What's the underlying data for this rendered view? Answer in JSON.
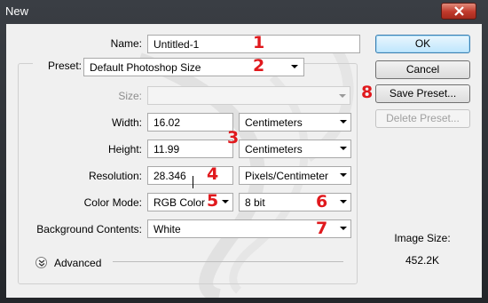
{
  "window": {
    "title": "New"
  },
  "form": {
    "name_label": "Name:",
    "name_value": "Untitled-1",
    "preset_label": "Preset:",
    "preset_value": "Default Photoshop Size",
    "size_label": "Size:",
    "size_value": "",
    "width_label": "Width:",
    "width_value": "16.02",
    "width_unit": "Centimeters",
    "height_label": "Height:",
    "height_value": "11.99",
    "height_unit": "Centimeters",
    "resolution_label": "Resolution:",
    "resolution_value": "28.346",
    "resolution_unit": "Pixels/Centimeter",
    "color_mode_label": "Color Mode:",
    "color_mode_value": "RGB Color",
    "bit_depth_value": "8 bit",
    "background_label": "Background Contents:",
    "background_value": "White",
    "advanced_label": "Advanced"
  },
  "buttons": {
    "ok": "OK",
    "cancel": "Cancel",
    "save_preset": "Save Preset...",
    "delete_preset": "Delete Preset..."
  },
  "image_size": {
    "label": "Image Size:",
    "value": "452.2K"
  },
  "annotations": [
    "1",
    "2",
    "3",
    "4",
    "5",
    "6",
    "7",
    "8"
  ],
  "colors": {
    "annotation": "#e0191d",
    "ok_border": "#3c7fb1",
    "titlebar": "#2f3338"
  }
}
